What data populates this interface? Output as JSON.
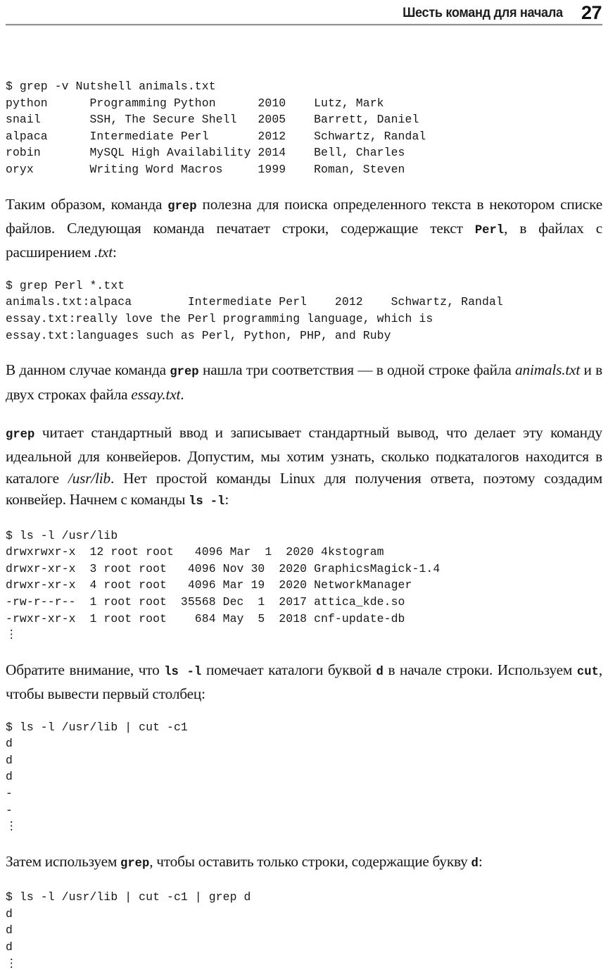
{
  "page": {
    "running_head": "Шесть команд для начала",
    "page_number": "27"
  },
  "blocks": {
    "code_grep_v": {
      "command": "$ grep -v Nutshell animals.txt",
      "output": "python      Programming Python      2010    Lutz, Mark\nsnail       SSH, The Secure Shell   2005    Barrett, Daniel\nalpaca      Intermediate Perl       2012    Schwartz, Randal\nrobin       MySQL High Availability 2014    Bell, Charles\noryx        Writing Word Macros     1999    Roman, Steven"
    },
    "para_1": {
      "part1": "Таким образом, команда ",
      "mono1": "grep",
      "part2": " полезна для поиска определенного текста в некотором списке файлов. Следующая команда печатает строки, содержащие текст ",
      "mono2": "Perl",
      "part3": ", в файлах с расширением ",
      "ital1": ".txt",
      "part4": ":"
    },
    "code_grep_perl": {
      "command": "$ grep Perl *.txt",
      "output": "animals.txt:alpaca        Intermediate Perl    2012    Schwartz, Randal\nessay.txt:really love the Perl programming language, which is\nessay.txt:languages such as Perl, Python, PHP, and Ruby"
    },
    "para_2": {
      "part1": "В данном случае команда ",
      "mono1": "grep",
      "part2": " нашла три соответствия — в одной строке файла ",
      "ital1": "animals.txt",
      "part3": " и в двух строках файла ",
      "ital2": "essay.txt",
      "part4": "."
    },
    "para_3": {
      "mono1": "grep",
      "part1": " читает стандартный ввод и записывает стандартный вывод, что делает эту команду идеальной для конвейеров. Допустим, мы хотим узнать, сколько подкаталогов находится в каталоге ",
      "ital1": "/usr/lib",
      "part2": ". Нет простой команды Linux для получения ответа, поэтому создадим конвейер. Начнем с команды ",
      "mono2": "ls -l",
      "part3": ":"
    },
    "code_ls": {
      "command": "$ ls -l /usr/lib",
      "output": "drwxrwxr-x  12 root root   4096 Mar  1  2020 4kstogram\ndrwxr-xr-x  3 root root   4096 Nov 30  2020 GraphicsMagick-1.4\ndrwxr-xr-x  4 root root   4096 Mar 19  2020 NetworkManager\n-rw-r--r--  1 root root  35568 Dec  1  2017 attica_kde.so\n-rwxr-xr-x  1 root root    684 May  5  2018 cnf-update-db",
      "ellipsis": "⋮"
    },
    "para_4": {
      "part1": "Обратите внимание, что ",
      "mono1": "ls -l",
      "part2": " помечает каталоги буквой ",
      "mono2": "d",
      "part3": " в начале строки. Используем ",
      "mono3": "cut",
      "part4": ", чтобы вывести первый столбец:"
    },
    "code_cut": {
      "command": "$ ls -l /usr/lib | cut -c1",
      "output": "d\nd\nd\n-\n-",
      "ellipsis": "⋮"
    },
    "para_5": {
      "part1": "Затем используем ",
      "mono1": "grep",
      "part2": ", чтобы оставить только строки, содержащие букву ",
      "mono2": "d",
      "part3": ":"
    },
    "code_cut_grep": {
      "command": "$ ls -l /usr/lib | cut -c1 | grep d",
      "output": "d\nd\nd",
      "ellipsis": "⋮"
    }
  }
}
